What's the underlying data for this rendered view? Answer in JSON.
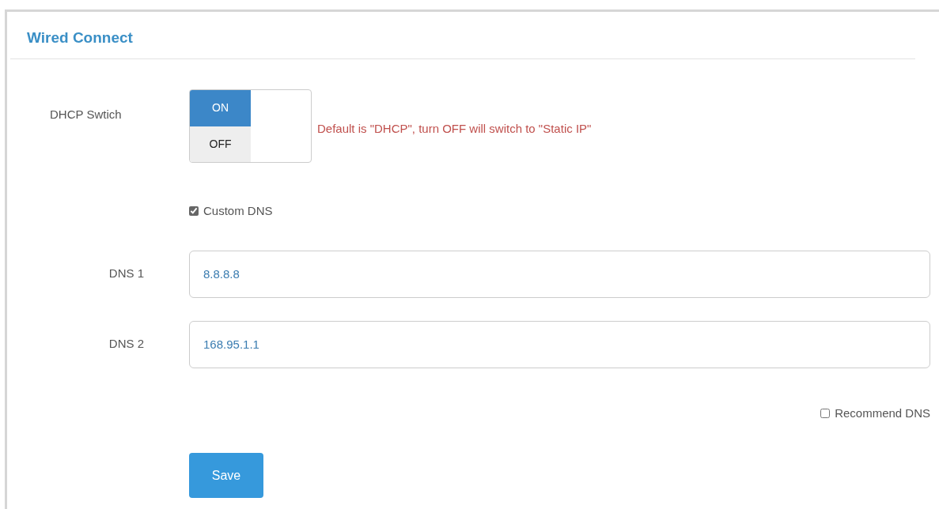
{
  "panel": {
    "title": "Wired Connect"
  },
  "dhcp": {
    "label": "DHCP Swtich",
    "on_label": "ON",
    "off_label": "OFF",
    "on": true,
    "hint": "Default is \"DHCP\", turn OFF will switch to \"Static IP\""
  },
  "custom_dns": {
    "label": "Custom DNS",
    "checked": true
  },
  "dns_fields": [
    {
      "label": "DNS 1",
      "value": "8.8.8.8"
    },
    {
      "label": "DNS 2",
      "value": "168.95.1.1"
    }
  ],
  "recommend_dns": {
    "label": "Recommend DNS",
    "checked": false
  },
  "save_button": "Save"
}
